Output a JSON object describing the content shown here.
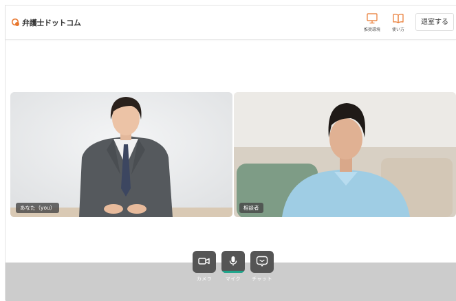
{
  "header": {
    "logo_text": "弁護士ドットコム",
    "tools": [
      {
        "label": "推奨環境",
        "icon": "monitor-icon"
      },
      {
        "label": "使い方",
        "icon": "book-icon"
      }
    ],
    "exit_label": "退室する"
  },
  "participants": [
    {
      "label": "あなた（you）",
      "role": "self"
    },
    {
      "label": "相談者",
      "role": "remote"
    }
  ],
  "controls": [
    {
      "label": "カメラ",
      "icon": "camera-icon",
      "active": false
    },
    {
      "label": "マイク",
      "icon": "microphone-icon",
      "active": true
    },
    {
      "label": "チャット",
      "icon": "chat-icon",
      "active": false
    }
  ],
  "colors": {
    "brand": "#e8772e",
    "active": "#1ea58b",
    "control_bg": "#555555",
    "bottom_bar": "#cccccc"
  }
}
